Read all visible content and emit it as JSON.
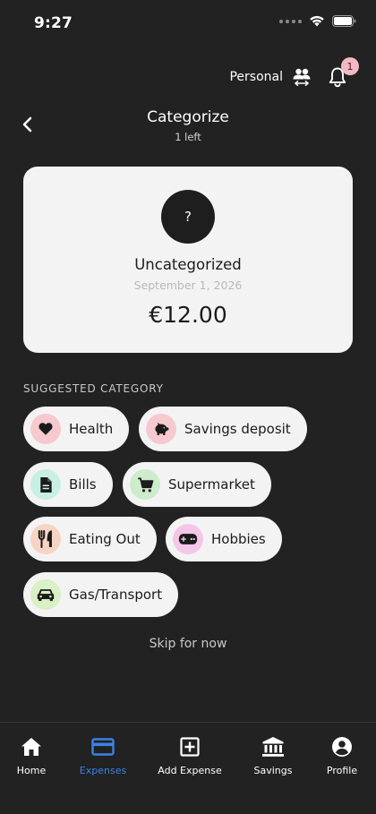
{
  "status_bar": {
    "time": "9:27"
  },
  "account": {
    "label": "Personal",
    "notification_count": "1"
  },
  "header": {
    "title": "Categorize",
    "subtitle": "1 left"
  },
  "transaction": {
    "avatar_symbol": "?",
    "name": "Uncategorized",
    "date": "September 1, 2026",
    "amount": "€12.00"
  },
  "suggested": {
    "label": "SUGGESTED CATEGORY",
    "categories": [
      {
        "label": "Health",
        "icon": "heart-icon",
        "color": "#f6c9cf"
      },
      {
        "label": "Savings deposit",
        "icon": "piggy-bank-icon",
        "color": "#f6c9cf"
      },
      {
        "label": "Bills",
        "icon": "document-icon",
        "color": "#c8efe4"
      },
      {
        "label": "Supermarket",
        "icon": "cart-icon",
        "color": "#cdeccc"
      },
      {
        "label": "Eating Out",
        "icon": "utensils-icon",
        "color": "#f6d4c3"
      },
      {
        "label": "Hobbies",
        "icon": "gamepad-icon",
        "color": "#f4c6e8"
      },
      {
        "label": "Gas/Transport",
        "icon": "car-icon",
        "color": "#d9efc4"
      }
    ]
  },
  "skip_label": "Skip for now",
  "nav": {
    "active_color": "#3b82e6",
    "items": [
      {
        "label": "Home",
        "icon": "home-icon"
      },
      {
        "label": "Expenses",
        "icon": "card-icon",
        "active": true
      },
      {
        "label": "Add Expense",
        "icon": "plus-box-icon"
      },
      {
        "label": "Savings",
        "icon": "bank-icon"
      },
      {
        "label": "Profile",
        "icon": "profile-icon"
      }
    ]
  }
}
